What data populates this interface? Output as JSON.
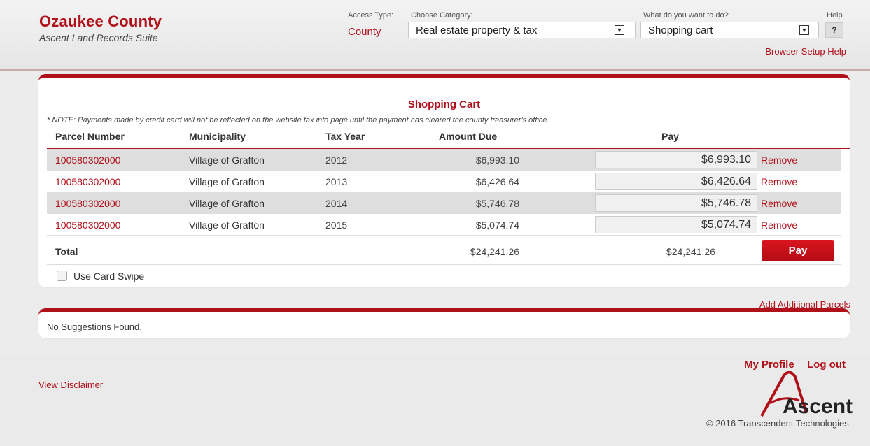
{
  "header": {
    "title": "Ozaukee County",
    "subtitle": "Ascent Land Records Suite",
    "access_type_label": "Access Type:",
    "access_type_value": "County",
    "category_label": "Choose Category:",
    "category_value": "Real estate property & tax",
    "action_label": "What do you want to do?",
    "action_value": "Shopping cart",
    "help_label": "Help",
    "help_button": "?",
    "browser_setup_help": "Browser Setup Help"
  },
  "cart": {
    "title": "Shopping Cart",
    "note": "* NOTE: Payments made by credit card will not be reflected on the website tax info page until the payment has cleared the county treasurer's office.",
    "columns": {
      "parcel": "Parcel Number",
      "municipality": "Municipality",
      "tax_year": "Tax Year",
      "amount_due": "Amount Due",
      "pay": "Pay"
    },
    "rows": [
      {
        "parcel": "100580302000",
        "municipality": "Village of Grafton",
        "tax_year": "2012",
        "amount_due": "$6,993.10",
        "pay": "$6,993.10",
        "remove": "Remove"
      },
      {
        "parcel": "100580302000",
        "municipality": "Village of Grafton",
        "tax_year": "2013",
        "amount_due": "$6,426.64",
        "pay": "$6,426.64",
        "remove": "Remove"
      },
      {
        "parcel": "100580302000",
        "municipality": "Village of Grafton",
        "tax_year": "2014",
        "amount_due": "$5,746.78",
        "pay": "$5,746.78",
        "remove": "Remove"
      },
      {
        "parcel": "100580302000",
        "municipality": "Village of Grafton",
        "tax_year": "2015",
        "amount_due": "$5,074.74",
        "pay": "$5,074.74",
        "remove": "Remove"
      }
    ],
    "total_label": "Total",
    "total_amount_due": "$24,241.26",
    "total_pay": "$24,241.26",
    "pay_button": "Pay",
    "card_swipe_label": "Use Card Swipe"
  },
  "add_parcels": "Add Additional Parcels",
  "suggestions": {
    "text": "No Suggestions Found."
  },
  "footer": {
    "my_profile": "My Profile",
    "logout": "Log out",
    "disclaimer": "View Disclaimer",
    "logo_text": "Ascent",
    "copyright": "© 2016 Transcendent Technologies"
  },
  "colors": {
    "brand_red": "#b0101a",
    "row_alt": "#dedede"
  }
}
